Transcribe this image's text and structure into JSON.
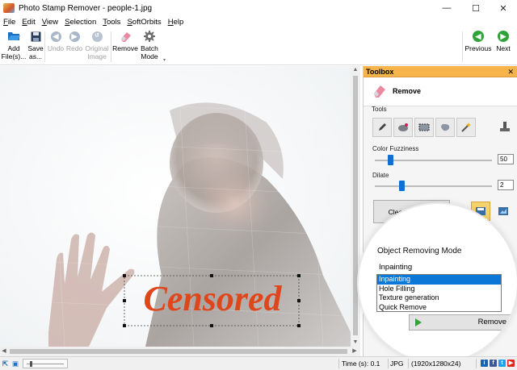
{
  "window": {
    "title": "Photo Stamp Remover - people-1.jpg",
    "minimize": "—",
    "maximize": "☐",
    "close": "✕"
  },
  "menu": [
    "File",
    "Edit",
    "View",
    "Selection",
    "Tools",
    "SoftOrbits",
    "Help"
  ],
  "toolbar": {
    "add_files_1": "Add",
    "add_files_2": "File(s)...",
    "save_as_1": "Save",
    "save_as_2": "as...",
    "undo": "Undo",
    "redo": "Redo",
    "original_1": "Original",
    "original_2": "Image",
    "remove": "Remove",
    "batch_1": "Batch",
    "batch_2": "Mode",
    "previous": "Previous",
    "next": "Next"
  },
  "canvas": {
    "stamp_text": "Censored"
  },
  "toolbox": {
    "header": "Toolbox",
    "close": "✕",
    "remove_label": "Remove",
    "tools_label": "Tools",
    "color_fuzziness_label": "Color Fuzziness",
    "color_fuzziness_value": "50",
    "dilate_label": "Dilate",
    "dilate_value": "2",
    "clear_selection": "Clear Selection"
  },
  "removing_mode": {
    "label": "Object Removing Mode",
    "current": "Inpainting",
    "options": [
      "Inpainting",
      "Hole Filling",
      "Texture generation",
      "Quick Remove"
    ],
    "selected_index": 0,
    "remove_button": "Remove"
  },
  "status": {
    "time": "Time (s): 0.1",
    "format": "JPG",
    "dimensions": "(1920x1280x24)"
  }
}
